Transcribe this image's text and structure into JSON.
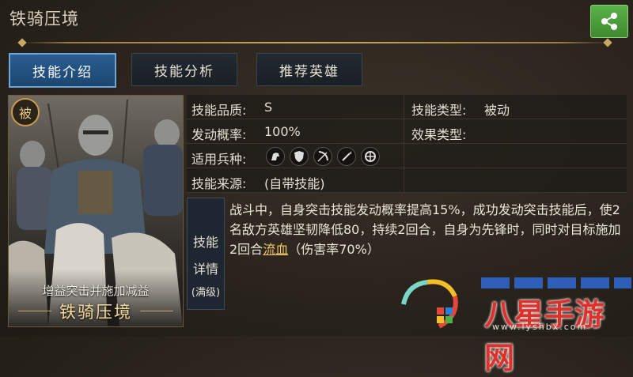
{
  "header": {
    "title": "铁骑压境"
  },
  "tabs": [
    {
      "label": "技能介绍",
      "active": true
    },
    {
      "label": "技能分析",
      "active": false
    },
    {
      "label": "推荐英雄",
      "active": false
    }
  ],
  "card": {
    "badge": "被",
    "subtitle": "增益突击并施加减益",
    "name": "铁骑压境"
  },
  "info": {
    "quality_label": "技能品质:",
    "quality_value": "S",
    "type_label": "技能类型:",
    "type_value": "被动",
    "rate_label": "发动概率:",
    "rate_value": "100%",
    "effect_label": "效果类型:",
    "effect_value": "",
    "troops_label": "适用兵种:",
    "troop_icons": [
      "cavalry-icon",
      "shield-icon",
      "bow-icon",
      "spear-icon",
      "siege-wheel-icon"
    ],
    "source_label": "技能来源:",
    "source_value": "(自带技能)"
  },
  "detail": {
    "label_line1": "技能",
    "label_line2": "详情",
    "label_line3": "(满级)",
    "text_part1": "战斗中，自身突击技能发动概率提高15%，成功发动突击技能后，使2名敌方英雄坚韧降低80，持续2回合，自身为先锋时，同时对目标施加2回合",
    "link": "流血",
    "text_part2": "（伤害率70%）"
  },
  "watermark": {
    "text": "八星手游网",
    "url": "www.lyshbx.com"
  },
  "colors": {
    "accent_gold": "#c9a862",
    "tab_active": "#2a5e8f",
    "share_green": "#4a9e38",
    "link": "#f3c86a"
  }
}
